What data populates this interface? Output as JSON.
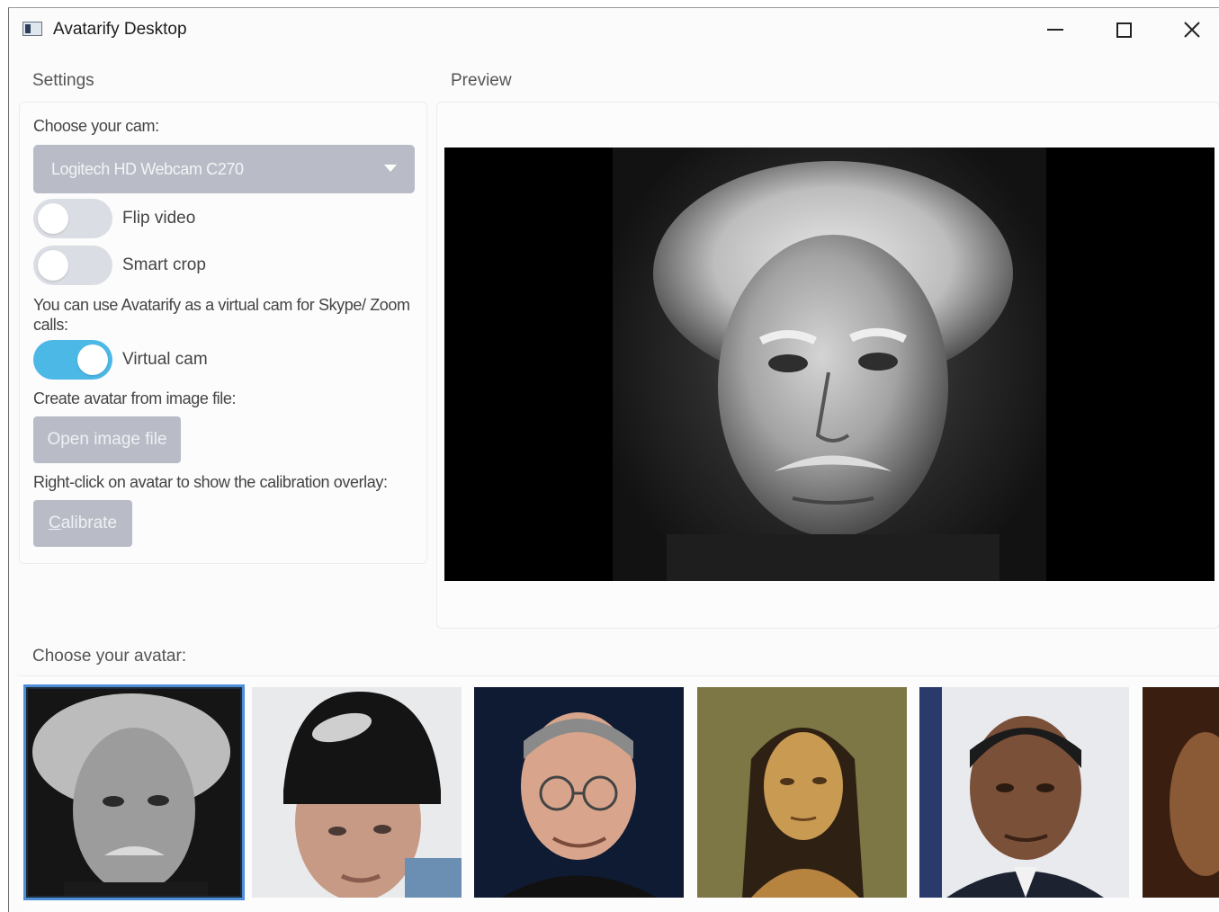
{
  "window": {
    "title": "Avatarify Desktop",
    "controls": {
      "minimize": "minimize",
      "maximize": "maximize",
      "close": "close"
    }
  },
  "settings": {
    "section_label": "Settings",
    "cam_label": "Choose your cam:",
    "cam_selected": "Logitech HD Webcam C270",
    "flip_video": {
      "label": "Flip video",
      "on": false
    },
    "smart_crop": {
      "label": "Smart crop",
      "on": false
    },
    "virtual_cam_note": "You can use Avatarify as a virtual cam for Skype/ Zoom calls:",
    "virtual_cam": {
      "label": "Virtual cam",
      "on": true
    },
    "create_avatar_label": "Create avatar from image file:",
    "open_image_button": "Open image file",
    "calibration_note": "Right-click on avatar to show the calibration overlay:",
    "calibrate_button_first": "C",
    "calibrate_button_rest": "alibrate"
  },
  "preview": {
    "section_label": "Preview"
  },
  "avatars": {
    "section_label": "Choose your avatar:",
    "selected_index": 0
  },
  "colors": {
    "accent": "#4cb8e6",
    "disabled_control": "#b9bcc6",
    "selection_outline": "#4c8ed8"
  }
}
